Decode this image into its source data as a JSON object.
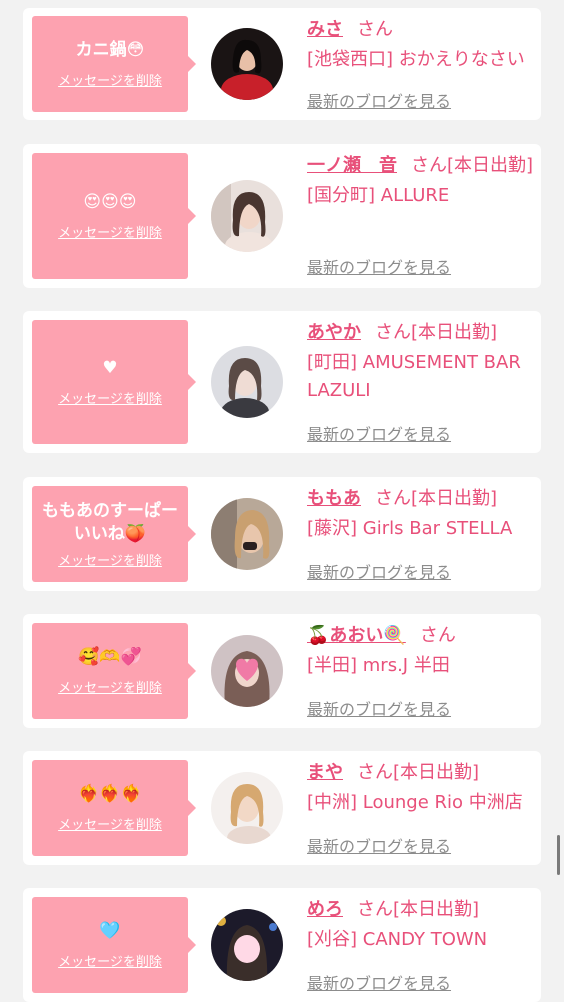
{
  "common": {
    "delete_label": "メッセージを削除",
    "blog_label": "最新のブログを見る",
    "san": "さん"
  },
  "colors": {
    "accent": "#e8507a",
    "bubble": "#fda2b0",
    "link_gray": "#8c8c8c",
    "background": "#f2f2f2"
  },
  "cards": [
    {
      "message": "カニ鍋😳",
      "name": "みさ",
      "status": "",
      "shop": "[池袋西口] おかえりなさい",
      "avatar": "woman-in-red-photo"
    },
    {
      "message": "😍😍😍",
      "name": "一ノ瀬　音",
      "status": "[本日出勤]",
      "shop": "[国分町] ALLURE",
      "avatar": "woman-portrait-photo"
    },
    {
      "message": "♥",
      "name": "あやか",
      "status": "[本日出勤]",
      "shop": "[町田] AMUSEMENT BAR LAZULI",
      "avatar": "woman-selfie-photo"
    },
    {
      "message": "ももあのすーぱーいいね🍑",
      "name": "ももあ",
      "status": "[本日出勤]",
      "shop": "[藤沢] Girls Bar STELLA",
      "avatar": "woman-blonde-photo"
    },
    {
      "message": "🥰🫶💞",
      "name": "🍒あおい🍭",
      "status": "",
      "shop": "[半田] mrs.J 半田",
      "avatar": "woman-heart-sticker-photo"
    },
    {
      "message": "❤️‍🔥❤️‍🔥❤️‍🔥",
      "name": "まや",
      "status": "[本日出勤]",
      "shop": "[中洲] Lounge Rio 中洲店",
      "avatar": "woman-smiling-photo"
    },
    {
      "message": "🩵",
      "name": "めろ",
      "status": "[本日出勤]",
      "shop": "[刈谷] CANDY TOWN",
      "avatar": "woman-night-photo"
    }
  ]
}
